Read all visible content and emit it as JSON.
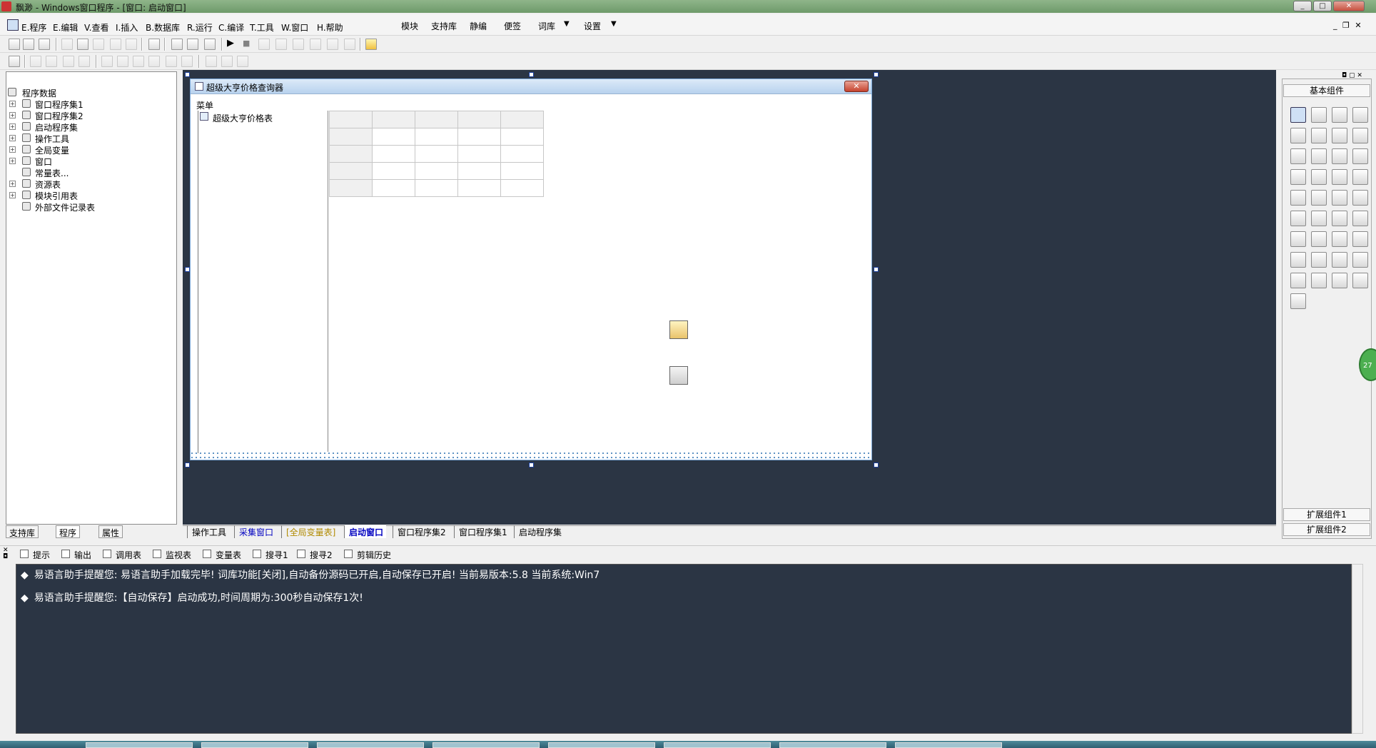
{
  "window": {
    "title": "飘渺 - Windows窗口程序 - [窗口: 启动窗口]",
    "min": "_",
    "max": "□",
    "close": "✕"
  },
  "menubar": {
    "items": [
      {
        "label": "E.程序"
      },
      {
        "label": "E.编辑"
      },
      {
        "label": "V.查看"
      },
      {
        "label": "I.插入"
      },
      {
        "label": "B.数据库"
      },
      {
        "label": "R.运行"
      },
      {
        "label": "C.编译"
      },
      {
        "label": "T.工具"
      },
      {
        "label": "W.窗口"
      },
      {
        "label": "H.帮助"
      }
    ],
    "extra": [
      {
        "label": "模块"
      },
      {
        "label": "支持库"
      },
      {
        "label": "静编"
      },
      {
        "label": "便签"
      },
      {
        "label": "词库"
      },
      {
        "label": "设置"
      }
    ],
    "dropdown_glyph": "▼",
    "mdi_controls": "_ ❐ ✕"
  },
  "left_panel": {
    "tree": [
      {
        "label": "程序数据",
        "icon": "folder-icon",
        "level": 0,
        "expander": ""
      },
      {
        "label": "窗口程序集1",
        "icon": "module-icon",
        "level": 1,
        "expander": "+"
      },
      {
        "label": "窗口程序集2",
        "icon": "module-icon",
        "level": 1,
        "expander": "+"
      },
      {
        "label": "启动程序集",
        "icon": "module-icon",
        "level": 1,
        "expander": "+"
      },
      {
        "label": "操作工具",
        "icon": "module-icon",
        "level": 1,
        "expander": "+"
      },
      {
        "label": "全局变量",
        "icon": "variable-icon",
        "level": 1,
        "expander": "+"
      },
      {
        "label": "窗口",
        "icon": "window-icon",
        "level": 1,
        "expander": "+"
      },
      {
        "label": "常量表...",
        "icon": "constant-icon",
        "level": 1,
        "expander": ""
      },
      {
        "label": "资源表",
        "icon": "resource-icon",
        "level": 1,
        "expander": "+"
      },
      {
        "label": "模块引用表",
        "icon": "reference-icon",
        "level": 1,
        "expander": "+"
      },
      {
        "label": "外部文件记录表",
        "icon": "file-icon",
        "level": 1,
        "expander": ""
      }
    ],
    "tabs": [
      {
        "label": "支持库"
      },
      {
        "label": "程序"
      },
      {
        "label": "属性"
      }
    ]
  },
  "form": {
    "title": "超级大亨价格查询器",
    "close_label": "✕",
    "menu_label": "菜单",
    "tree_item": "超级大亨价格表"
  },
  "designer_tabs": [
    {
      "label": "操作工具",
      "color": "#000000"
    },
    {
      "label": "采集窗口",
      "color": "#0000c0"
    },
    {
      "label": "[全局变量表]",
      "color": "#b08a00"
    },
    {
      "label": "启动窗口",
      "color": "#0000c0"
    },
    {
      "label": "窗口程序集2",
      "color": "#000000"
    },
    {
      "label": "窗口程序集1",
      "color": "#000000"
    },
    {
      "label": "启动程序集",
      "color": "#000000"
    }
  ],
  "right_panel": {
    "header": "基本组件",
    "ext1": "扩展组件1",
    "ext2": "扩展组件2"
  },
  "output_tabs": [
    {
      "label": "提示",
      "icon": "hint-icon"
    },
    {
      "label": "输出",
      "icon": "output-icon"
    },
    {
      "label": "调用表",
      "icon": "callstack-icon"
    },
    {
      "label": "监视表",
      "icon": "watch-icon"
    },
    {
      "label": "变量表",
      "icon": "variables-icon"
    },
    {
      "label": "搜寻1",
      "icon": "search1-icon"
    },
    {
      "label": "搜寻2",
      "icon": "search2-icon"
    },
    {
      "label": "剪辑历史",
      "icon": "clipboard-icon"
    }
  ],
  "output_lines": [
    "易语言助手提醒您:  易语言助手加载完毕! 词库功能[关闭],自动备份源码已开启,自动保存已开启! 当前易版本:5.8  当前系统:Win7",
    "易语言助手提醒您:【自动保存】启动成功,时间周期为:300秒自动保存1次!"
  ],
  "output_bullet": "◆",
  "green_badge": "27",
  "colors": {
    "designer_bg": "#2b3544",
    "title_bar": "#7aa676",
    "accent_blue": "#0000c0"
  }
}
